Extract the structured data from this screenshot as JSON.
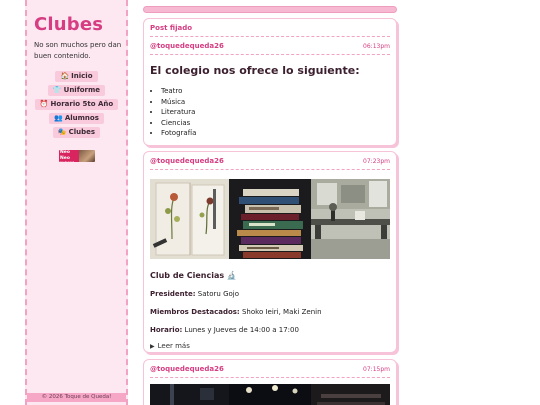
{
  "sidebar": {
    "title": "Clubes",
    "description": "No son muchos pero dan buen contenido.",
    "nav": [
      {
        "icon": "🏠",
        "label": "Inicio"
      },
      {
        "icon": "👕",
        "label": "Uniforme"
      },
      {
        "icon": "⏰",
        "label": "Horario 5to Año"
      },
      {
        "icon": "👥",
        "label": "Alumnos"
      },
      {
        "icon": "🎭",
        "label": "Clubes"
      }
    ],
    "badge_text": "Neo Neo NOW!",
    "footer": "© 2026 Toque de Queda!"
  },
  "posts": [
    {
      "pinned_label": "Post fijado",
      "user": "@toquedequeda26",
      "time": "06:13pm",
      "heading": "El colegio nos ofrece lo siguiente:",
      "items": [
        "Teatro",
        "Música",
        "Literatura",
        "Ciencias",
        "Fotografía"
      ]
    },
    {
      "user": "@toquedequeda26",
      "time": "07:23pm",
      "club_title": "Club de Ciencias 🔬",
      "president_label": "Presidente:",
      "president": "Satoru Gojo",
      "members_label": "Miembros Destacados:",
      "members": "Shoko Ieiri, Maki Zenin",
      "schedule_label": "Horario:",
      "schedule": "Lunes y Jueves de 14:00 a 17:00",
      "more": "Leer más"
    },
    {
      "user": "@toquedequeda26",
      "time": "07:15pm"
    }
  ],
  "colors": {
    "accent": "#d63d82",
    "sidebar_bg": "#fde8f1",
    "nav_bg": "#f9c9dc",
    "border": "#f7c3d8"
  }
}
